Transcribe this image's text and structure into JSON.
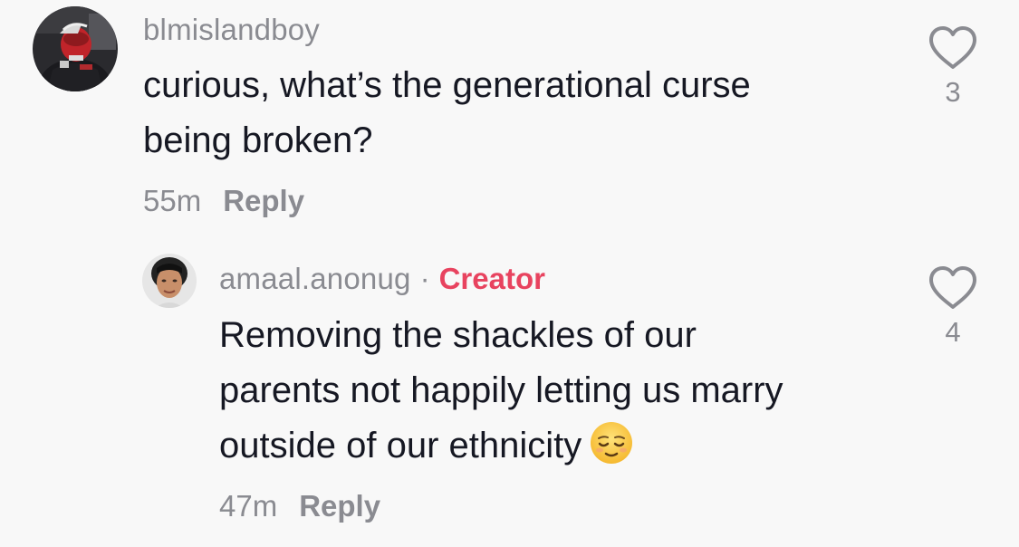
{
  "comments": [
    {
      "username": "blmislandboy",
      "text_lines": [
        "curious, what’s the generational curse",
        "being broken?"
      ],
      "time": "55m",
      "reply_label": "Reply",
      "like_count": "3",
      "avatar": "profile-photo"
    }
  ],
  "replies": [
    {
      "username": "amaal.anonug",
      "separator": "·",
      "badge": "Creator",
      "badge_color": "#e8435f",
      "text_lines": [
        "Removing the shackles of our",
        "parents not happily letting us marry",
        "outside of our ethnicity"
      ],
      "emoji": "relieved-face",
      "time": "47m",
      "reply_label": "Reply",
      "like_count": "4",
      "avatar": "profile-photo"
    }
  ],
  "colors": {
    "background": "#f8f8f8",
    "text_primary": "#161823",
    "text_secondary": "#8a8b91"
  },
  "icons": [
    "heart-outline-icon",
    "heart-outline-icon"
  ]
}
